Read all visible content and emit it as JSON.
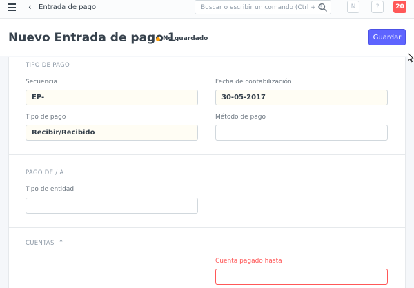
{
  "navbar": {
    "title": "Entrada de pago",
    "search_placeholder": "Buscar o escribir un comando (Ctrl + G)",
    "user_initial": "N",
    "help": "?",
    "notifications": "20"
  },
  "page": {
    "title": "Nuevo Entrada de pago 1",
    "status": "No guardado",
    "save_label": "Guardar"
  },
  "sections": {
    "payment_type": {
      "heading": "TIPO DE PAGO",
      "series_label": "Secuencia",
      "series_value": "EP-",
      "posting_date_label": "Fecha de contabilización",
      "posting_date_value": "30-05-2017",
      "payment_type_label": "Tipo de pago",
      "payment_type_value": "Recibir/Recibido",
      "mode_of_payment_label": "Método de pago",
      "mode_of_payment_value": ""
    },
    "party": {
      "heading": "PAGO DE / A",
      "party_type_label": "Tipo de entidad",
      "party_type_value": ""
    },
    "accounts": {
      "heading": "CUENTAS",
      "paid_to_label": "Cuenta pagado hasta",
      "paid_to_value": ""
    }
  },
  "colors": {
    "primary": "#5e64ff",
    "status_dot": "#ffa00a",
    "notification": "#ff5858",
    "required": "#ff5858"
  }
}
